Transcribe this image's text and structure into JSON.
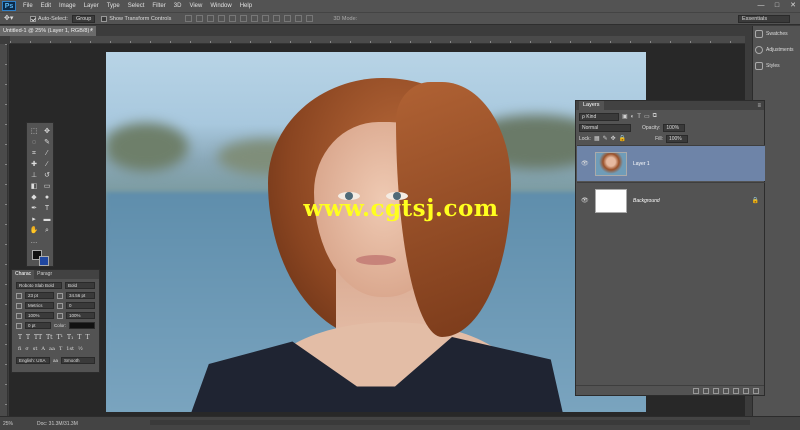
{
  "app": {
    "logo": "Ps"
  },
  "menu": [
    "File",
    "Edit",
    "Image",
    "Layer",
    "Type",
    "Select",
    "Filter",
    "3D",
    "View",
    "Window",
    "Help"
  ],
  "window_controls": [
    "—",
    "□",
    "✕"
  ],
  "options_bar": {
    "auto_select_label": "Auto-Select:",
    "auto_select_value": "Group",
    "show_transform_label": "Show Transform Controls",
    "mode3d_label": "3D Mode:",
    "workspace": "Essentials"
  },
  "document_tab": {
    "title": "Untitled-1 @ 25% (Layer 1, RGB/8) *",
    "close": "×"
  },
  "watermark": "www.cgtsj.com",
  "character_panel": {
    "tabs": [
      "Charac",
      "Paragr"
    ],
    "font_family": "Roboto Slab Bold",
    "font_style": "Bold",
    "size": "23 pt",
    "leading": "34.56 pt",
    "kerning": "Metrics",
    "tracking": "0",
    "vertical_scale": "100%",
    "horizontal_scale": "100%",
    "baseline_shift": "0 pt",
    "color_label": "Color:",
    "type_styles": [
      "T",
      "T",
      "TT",
      "Tt",
      "T¹",
      "T₁",
      "T",
      "T"
    ],
    "ot_styles": [
      "fi",
      "σ",
      "st",
      "A",
      "aa",
      "T",
      "1st",
      "½"
    ],
    "language": "English: USA",
    "aa_label": "aa",
    "anti_alias": "Smooth"
  },
  "right_dock": [
    {
      "icon": "swatches-icon",
      "label": "Swatches"
    },
    {
      "icon": "adjustments-icon",
      "label": "Adjustments"
    },
    {
      "icon": "styles-icon",
      "label": "Styles"
    }
  ],
  "layers_panel": {
    "tab": "Layers",
    "filter": "ρ Kind",
    "blend_mode": "Normal",
    "opacity_label": "Opacity:",
    "opacity": "100%",
    "lock_label": "Lock:",
    "fill_label": "Fill:",
    "fill": "100%",
    "layers": [
      {
        "name": "Layer 1",
        "selected": true
      },
      {
        "name": "Background",
        "selected": false
      }
    ]
  },
  "status_bar": {
    "zoom": "25%",
    "doc": "Doc: 31.3M/31.3M"
  },
  "colors": {
    "foreground": "#111111",
    "background": "#2047a0",
    "watermark": "#ffff1e",
    "selection": "#6e84a8"
  }
}
